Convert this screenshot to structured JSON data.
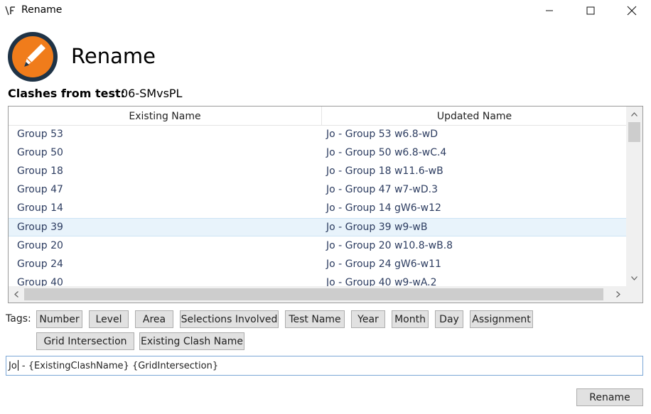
{
  "window": {
    "title": "Rename",
    "icon": "app-pen-icon"
  },
  "header": {
    "title": "Rename",
    "logo": "orange-pencil-logo"
  },
  "clashes": {
    "label": "Clashes from test:",
    "value": "06-SMvsPL"
  },
  "table": {
    "columns": [
      "Existing Name",
      "Updated Name"
    ],
    "rows": [
      {
        "existing": "Group 53",
        "updated": "Jo - Group 53 w6.8-wD",
        "selected": false
      },
      {
        "existing": "Group 50",
        "updated": "Jo - Group 50 w6.8-wC.4",
        "selected": false
      },
      {
        "existing": "Group 18",
        "updated": "Jo - Group 18 w11.6-wB",
        "selected": false
      },
      {
        "existing": "Group 47",
        "updated": "Jo - Group 47 w7-wD.3",
        "selected": false
      },
      {
        "existing": "Group 14",
        "updated": "Jo - Group 14 gW6-w12",
        "selected": false
      },
      {
        "existing": "Group 39",
        "updated": "Jo - Group 39 w9-wB",
        "selected": true
      },
      {
        "existing": "Group 20",
        "updated": "Jo - Group 20 w10.8-wB.8",
        "selected": false
      },
      {
        "existing": "Group 24",
        "updated": "Jo - Group 24 gW6-w11",
        "selected": false
      },
      {
        "existing": "Group 40",
        "updated": "Jo - Group 40 w9-wA.2",
        "selected": false
      }
    ]
  },
  "tags": {
    "label": "Tags:",
    "items": [
      "Number",
      "Level",
      "Area",
      "Selections Involved",
      "Test Name",
      "Year",
      "Month",
      "Day",
      "Assignment",
      "Grid Intersection",
      "Existing Clash Name"
    ]
  },
  "formula": {
    "before_caret": "Jo",
    "after_caret": " - {ExistingClashName} {GridIntersection}"
  },
  "actions": {
    "rename_label": "Rename"
  },
  "colors": {
    "logo_orange": "#f07c1b",
    "logo_dark": "#1f3346",
    "selection": "#e8f3fb",
    "row_text": "#2c3c60"
  }
}
